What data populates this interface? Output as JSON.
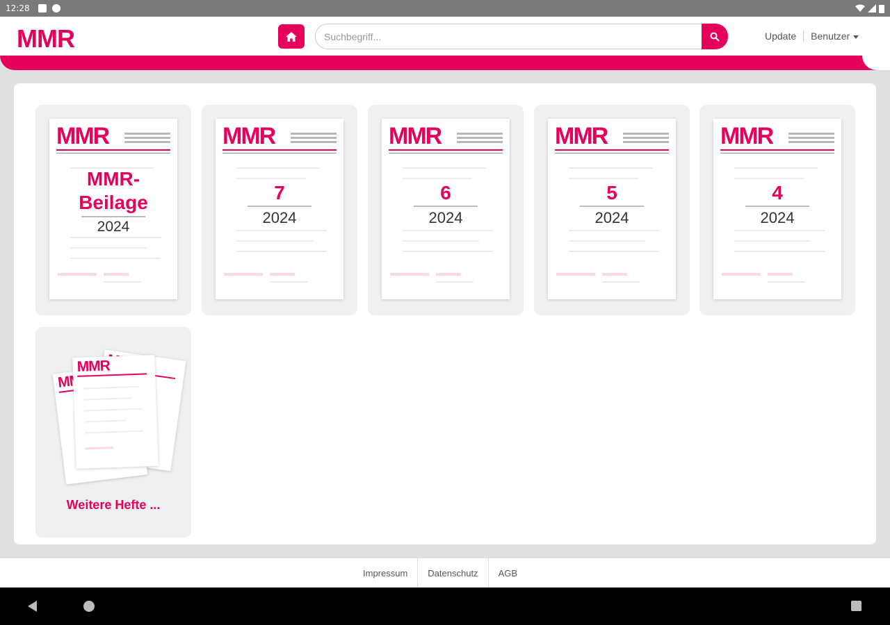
{
  "status_bar": {
    "time": "12:28"
  },
  "header": {
    "logo": "MMR",
    "search": {
      "placeholder": "Suchbegriff...",
      "value": ""
    },
    "links": {
      "update": "Update",
      "user": "Benutzer"
    }
  },
  "cover_brand": "MMR",
  "issues": [
    {
      "title_line1": "MMR-",
      "title_line2": "Beilage",
      "year": "2024"
    },
    {
      "number": "7",
      "year": "2024"
    },
    {
      "number": "6",
      "year": "2024"
    },
    {
      "number": "5",
      "year": "2024"
    },
    {
      "number": "4",
      "year": "2024"
    }
  ],
  "more_issues": {
    "label": "Weitere Hefte ..."
  },
  "footer": {
    "imprint": "Impressum",
    "privacy": "Datenschutz",
    "terms": "AGB"
  },
  "colors": {
    "brand": "#e5005c"
  },
  "icons": {
    "home": "home-icon",
    "search": "search-icon",
    "back": "nav-back-icon",
    "nav_home": "nav-home-icon",
    "recents": "nav-recents-icon"
  }
}
